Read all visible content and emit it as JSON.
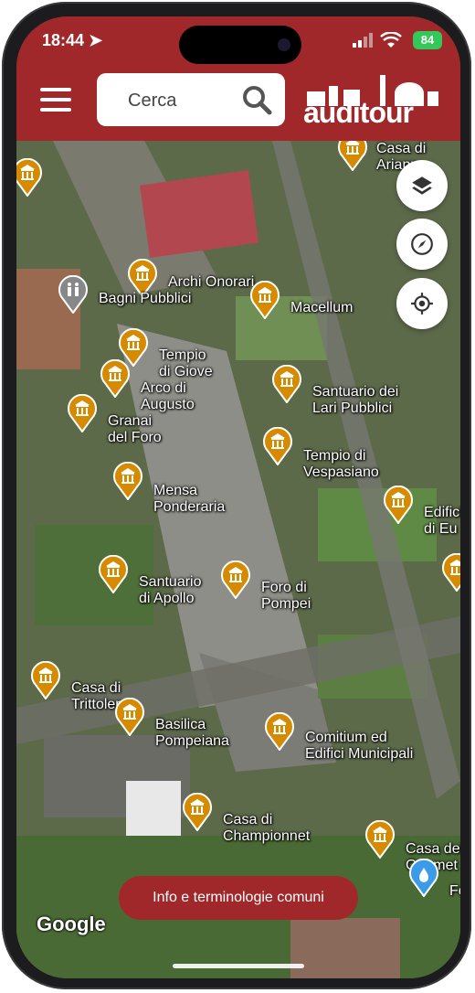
{
  "status_bar": {
    "time": "18:44",
    "battery": "84"
  },
  "search": {
    "placeholder": "Cerca"
  },
  "logo": {
    "text": "auditour"
  },
  "colors": {
    "brand": "#a0282a",
    "pin": "#d68a00",
    "user_location": "#3b9be8"
  },
  "map": {
    "attribution": "Google",
    "pins": [
      {
        "label": "Casa di\nAriann",
        "icon": "museum-icon"
      },
      {
        "label": "",
        "icon": "museum-icon"
      },
      {
        "label": "Archi Onorari",
        "icon": "museum-icon"
      },
      {
        "label": "Bagni Pubblici",
        "icon": "restroom-icon"
      },
      {
        "label": "Macellum",
        "icon": "museum-icon"
      },
      {
        "label": "Tempio\ndi Giove",
        "icon": "museum-icon"
      },
      {
        "label": "Arco di\nAugusto",
        "icon": "museum-icon"
      },
      {
        "label": "Granai\ndel Foro",
        "icon": "museum-icon"
      },
      {
        "label": "Santuario dei\nLari Pubblici",
        "icon": "museum-icon"
      },
      {
        "label": "Tempio di\nVespasiano",
        "icon": "museum-icon"
      },
      {
        "label": "Mensa\nPonderaria",
        "icon": "museum-icon"
      },
      {
        "label": "Edifici\ndi Eu",
        "icon": "museum-icon"
      },
      {
        "label": "Santuario\ndi Apollo",
        "icon": "museum-icon"
      },
      {
        "label": "Foro di\nPompei",
        "icon": "museum-icon"
      },
      {
        "label": "",
        "icon": "museum-icon"
      },
      {
        "label": "Casa di\nTrittolemo",
        "icon": "museum-icon"
      },
      {
        "label": "Basilica\nPompeiana",
        "icon": "museum-icon"
      },
      {
        "label": "Comitium ed\nEdifici Municipali",
        "icon": "museum-icon"
      },
      {
        "label": "Casa di\nChampionnet",
        "icon": "museum-icon"
      },
      {
        "label": "Casa dei\nGeomet",
        "icon": "museum-icon"
      },
      {
        "label": "Fo",
        "icon": "water-icon"
      }
    ]
  },
  "controls": {
    "layers": "layers-icon",
    "compass": "compass-icon",
    "location": "locate-icon"
  },
  "info_button": {
    "label": "Info e terminologie comuni"
  }
}
